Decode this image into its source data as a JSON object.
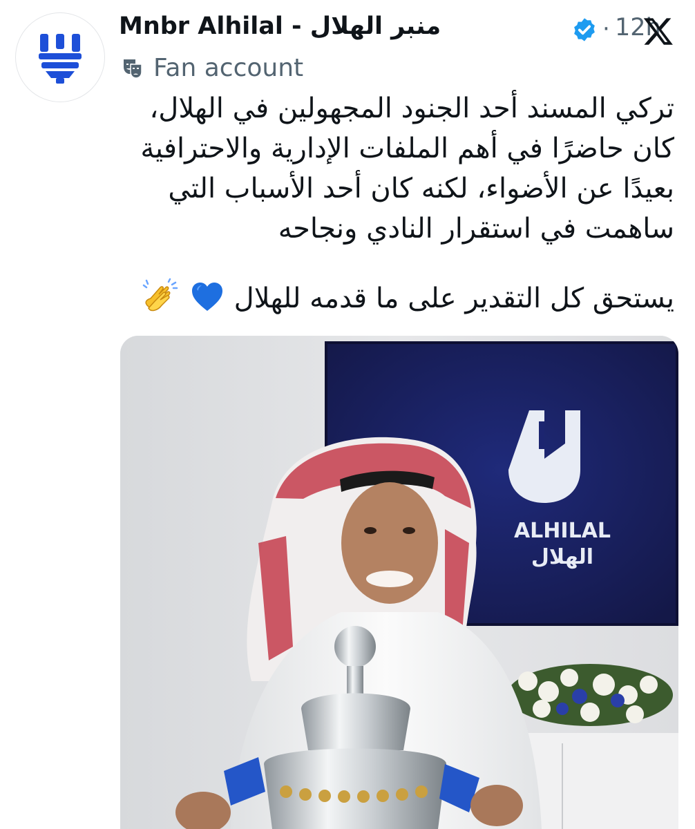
{
  "tweet": {
    "display_name": "Mnbr Alhilal - منبر الهلال",
    "separator": "·",
    "timestamp": "12h",
    "badge_label": "Fan account",
    "text_lines": [
      "تركي المسند أحد الجنود المجهولين في الهلال،",
      "كان حاضرًا في أهم الملفات الإدارية والاحترافية",
      "بعيدًا عن الأضواء، لكنه كان أحد الأسباب التي",
      "ساهمت في استقرار النادي ونجاحه"
    ],
    "closing_line": "يستحق كل التقدير على ما قدمه للهلال"
  },
  "icons": {
    "avatar": "alhilal-logo-icon",
    "verified": "verified-badge-icon",
    "x_logo": "x-logo-icon",
    "fan": "theater-masks-icon",
    "heart": "blue-heart-icon",
    "clap": "clapping-hands-icon"
  },
  "media": {
    "tv_logo_en": "ALHILAL",
    "tv_logo_ar": "الهلال"
  },
  "colors": {
    "brand_blue": "#1d4fd8",
    "verified_blue": "#1d9bf0",
    "secondary_text": "#536471",
    "tv_background": "#1a1f63"
  }
}
